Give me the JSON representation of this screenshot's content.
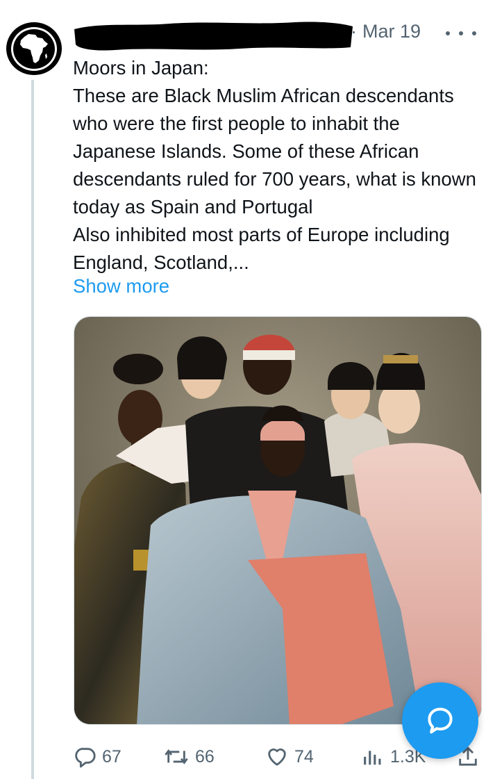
{
  "post": {
    "date": "Mar 19",
    "separator": "·",
    "text": "Moors in Japan:\nThese are Black Muslim African descendants who were the first people to inhabit the Japanese Islands. Some of these African descendants ruled for 700 years, what is known today as Spain and Portugal\nAlso inhibited most parts of Europe including England, Scotland,...",
    "show_more": "Show more"
  },
  "avatar": {
    "icon": "africa-map-icon"
  },
  "media": {
    "description_icon": "group-portrait-painting"
  },
  "actions": {
    "replies": "67",
    "reposts": "66",
    "likes": "74",
    "views": "1.3K"
  },
  "colors": {
    "accent": "#1d9bf0",
    "muted": "#536471",
    "text": "#0f1419",
    "border": "#cfd9de"
  }
}
